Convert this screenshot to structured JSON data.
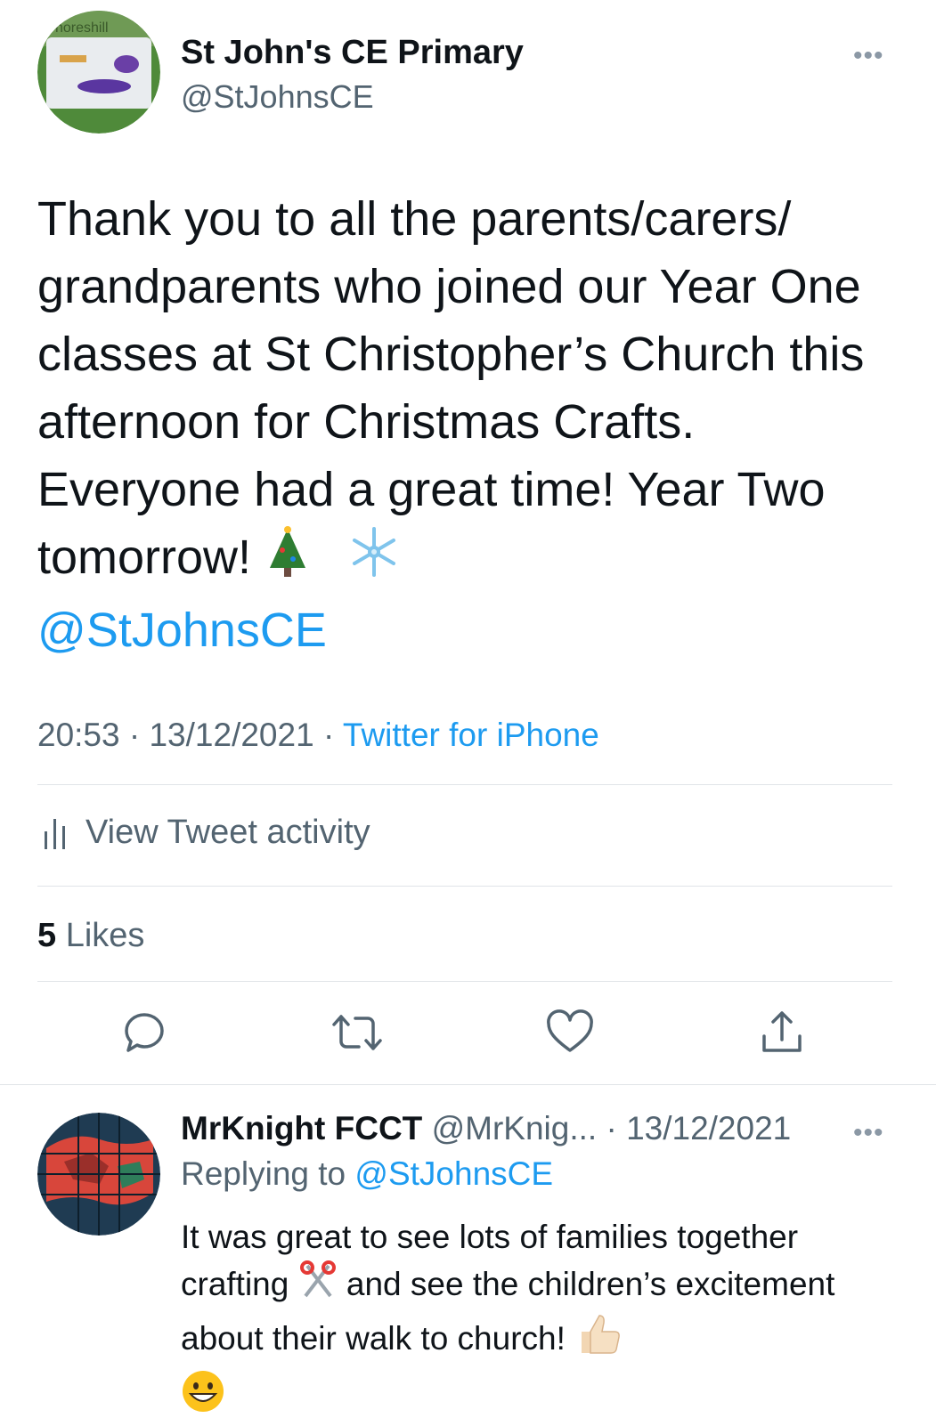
{
  "tweet": {
    "author_name": "St John's CE Primary",
    "author_handle": "@StJohnsCE",
    "avatar_text": "noreshill",
    "text_before": "Thank you to all the parents/carers/ grandparents who joined our Year One classes at St Christopher’s Church this afternoon for Christmas Crafts. Everyone had a great time! Year Two tomorrow!",
    "emojis": [
      "christmas-tree-icon",
      "snowflake-icon"
    ],
    "mention": "@StJohnsCE",
    "time": "20:53",
    "date": "13/12/2021",
    "separator": "·",
    "source": "Twitter for iPhone",
    "activity_label": "View Tweet activity",
    "likes_count": "5",
    "likes_label": "Likes",
    "more_label": "•••"
  },
  "actions": [
    "reply-icon",
    "retweet-icon",
    "like-icon",
    "share-icon"
  ],
  "reply": {
    "author_name": "MrKnight FCCT",
    "author_handle": "@MrKnig...",
    "separator": "·",
    "date": "13/12/2021",
    "replying_prefix": "Replying to",
    "replying_to": "@StJohnsCE",
    "text_part1": "It was great to see lots of families together crafting",
    "text_part2": "and see the children’s excitement about their walk to church!",
    "emojis": [
      "scissors-icon",
      "thumbs-up-icon",
      "grinning-face-icon"
    ],
    "more_label": "•••"
  },
  "colors": {
    "link": "#1d9bf0",
    "secondary": "#536471",
    "divider": "#e1e4e8"
  }
}
